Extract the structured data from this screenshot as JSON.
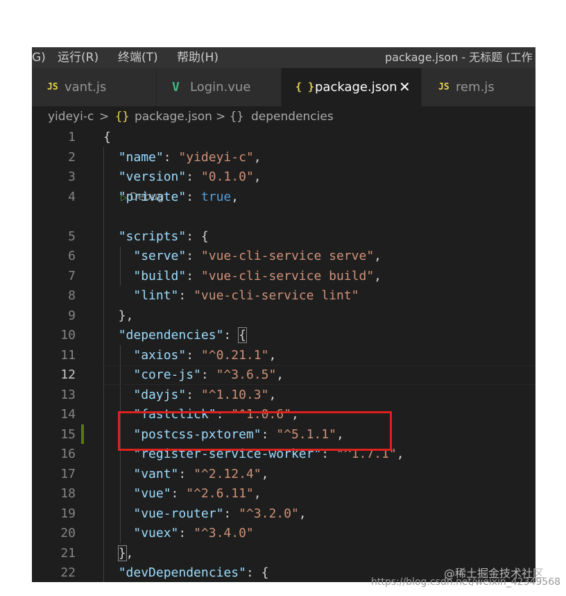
{
  "menubar": {
    "items": [
      "G)",
      "运行(R)",
      "终端(T)",
      "帮助(H)"
    ],
    "title": "package.json - 无标题 (工作"
  },
  "tabs": [
    {
      "icon": "JS",
      "label": "vant.js"
    },
    {
      "icon": "V",
      "label": "Login.vue"
    },
    {
      "icon": "{ }",
      "label": "package.json",
      "close": "✕"
    },
    {
      "icon": "JS",
      "label": "rem.js"
    }
  ],
  "breadcrumb": {
    "folder": "yideyi-c",
    "sep": ">",
    "file_icon": "{}",
    "file": "package.json",
    "node_icon": "{}",
    "node": "dependencies"
  },
  "codelens": {
    "label": "Debug"
  },
  "lines": [
    {
      "n": "1",
      "t": [
        [
          "p",
          "{"
        ]
      ]
    },
    {
      "n": "2",
      "t": [
        [
          "p",
          "  "
        ],
        [
          "k",
          "\"name\""
        ],
        [
          "p",
          ": "
        ],
        [
          "s",
          "\"yideyi-c\""
        ],
        [
          "p",
          ","
        ]
      ]
    },
    {
      "n": "3",
      "t": [
        [
          "p",
          "  "
        ],
        [
          "k",
          "\"version\""
        ],
        [
          "p",
          ": "
        ],
        [
          "s",
          "\"0.1.0\""
        ],
        [
          "p",
          ","
        ]
      ]
    },
    {
      "n": "4",
      "t": [
        [
          "p",
          "  "
        ],
        [
          "k",
          "\"private\""
        ],
        [
          "p",
          ": "
        ],
        [
          "b",
          "true"
        ],
        [
          "p",
          ","
        ]
      ]
    },
    {
      "n": "5",
      "t": [
        [
          "p",
          "  "
        ],
        [
          "k",
          "\"scripts\""
        ],
        [
          "p",
          ": {"
        ]
      ]
    },
    {
      "n": "6",
      "t": [
        [
          "p",
          "    "
        ],
        [
          "k",
          "\"serve\""
        ],
        [
          "p",
          ": "
        ],
        [
          "s",
          "\"vue-cli-service serve\""
        ],
        [
          "p",
          ","
        ]
      ]
    },
    {
      "n": "7",
      "t": [
        [
          "p",
          "    "
        ],
        [
          "k",
          "\"build\""
        ],
        [
          "p",
          ": "
        ],
        [
          "s",
          "\"vue-cli-service build\""
        ],
        [
          "p",
          ","
        ]
      ]
    },
    {
      "n": "8",
      "t": [
        [
          "p",
          "    "
        ],
        [
          "k",
          "\"lint\""
        ],
        [
          "p",
          ": "
        ],
        [
          "s",
          "\"vue-cli-service lint\""
        ]
      ]
    },
    {
      "n": "9",
      "t": [
        [
          "p",
          "  },"
        ]
      ]
    },
    {
      "n": "10",
      "t": [
        [
          "p",
          "  "
        ],
        [
          "k",
          "\"dependencies\""
        ],
        [
          "p",
          ": "
        ],
        [
          "pb",
          "{"
        ]
      ]
    },
    {
      "n": "11",
      "t": [
        [
          "p",
          "    "
        ],
        [
          "k",
          "\"axios\""
        ],
        [
          "p",
          ": "
        ],
        [
          "s",
          "\"^0.21.1\""
        ],
        [
          "p",
          ","
        ]
      ]
    },
    {
      "n": "12",
      "t": [
        [
          "p",
          "    "
        ],
        [
          "k",
          "\"core-js\""
        ],
        [
          "p",
          ": "
        ],
        [
          "s",
          "\"^3.6.5\""
        ],
        [
          "p",
          ","
        ]
      ]
    },
    {
      "n": "13",
      "t": [
        [
          "p",
          "    "
        ],
        [
          "k",
          "\"dayjs\""
        ],
        [
          "p",
          ": "
        ],
        [
          "s",
          "\"^1.10.3\""
        ],
        [
          "p",
          ","
        ]
      ]
    },
    {
      "n": "14",
      "t": [
        [
          "p",
          "    "
        ],
        [
          "k",
          "\"fastclick\""
        ],
        [
          "p",
          ": "
        ],
        [
          "s",
          "\"^1.0.6\""
        ],
        [
          "p",
          ","
        ]
      ]
    },
    {
      "n": "15",
      "t": [
        [
          "p",
          "    "
        ],
        [
          "k",
          "\"postcss-pxtorem\""
        ],
        [
          "p",
          ": "
        ],
        [
          "s",
          "\"^5.1.1\""
        ],
        [
          "p",
          ","
        ]
      ]
    },
    {
      "n": "16",
      "t": [
        [
          "p",
          "    "
        ],
        [
          "k",
          "\"register-service-worker\""
        ],
        [
          "p",
          ": "
        ],
        [
          "s",
          "\"^1.7.1\""
        ],
        [
          "p",
          ","
        ]
      ]
    },
    {
      "n": "17",
      "t": [
        [
          "p",
          "    "
        ],
        [
          "k",
          "\"vant\""
        ],
        [
          "p",
          ": "
        ],
        [
          "s",
          "\"^2.12.4\""
        ],
        [
          "p",
          ","
        ]
      ]
    },
    {
      "n": "18",
      "t": [
        [
          "p",
          "    "
        ],
        [
          "k",
          "\"vue\""
        ],
        [
          "p",
          ": "
        ],
        [
          "s",
          "\"^2.6.11\""
        ],
        [
          "p",
          ","
        ]
      ]
    },
    {
      "n": "19",
      "t": [
        [
          "p",
          "    "
        ],
        [
          "k",
          "\"vue-router\""
        ],
        [
          "p",
          ": "
        ],
        [
          "s",
          "\"^3.2.0\""
        ],
        [
          "p",
          ","
        ]
      ]
    },
    {
      "n": "20",
      "t": [
        [
          "p",
          "    "
        ],
        [
          "k",
          "\"vuex\""
        ],
        [
          "p",
          ": "
        ],
        [
          "s",
          "\"^3.4.0\""
        ]
      ]
    },
    {
      "n": "21",
      "t": [
        [
          "p",
          "  "
        ],
        [
          "pb",
          "}"
        ],
        [
          "p",
          ","
        ]
      ]
    },
    {
      "n": "22",
      "t": [
        [
          "p",
          "  "
        ],
        [
          "k",
          "\"devDependencies\""
        ],
        [
          "p",
          ": {"
        ]
      ]
    }
  ],
  "current_line": "12",
  "watermark": {
    "line1": "@稀土掘金技术社区",
    "line2": "https://blog.csdn.net/weixin_42349568"
  },
  "colors": {
    "key": "#9cdcfe",
    "string": "#ce9178",
    "keyword": "#569cd6",
    "highlight_box": "#e0201c",
    "editor_bg": "#1e1e1e"
  }
}
